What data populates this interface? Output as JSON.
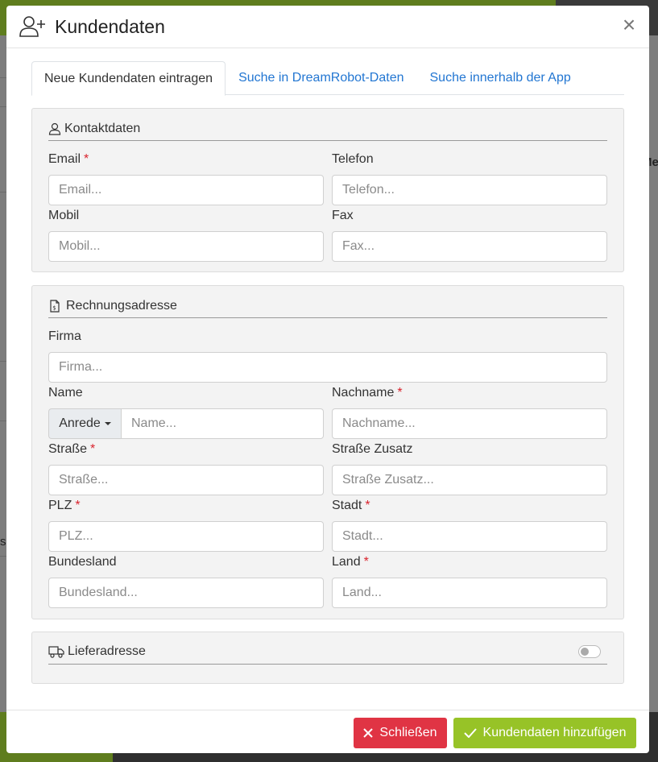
{
  "modal": {
    "title": "Kundendaten",
    "close_symbol": "×",
    "header_icon": "user-plus-icon"
  },
  "tabs": [
    {
      "label": "Neue Kundendaten eintragen",
      "active": true
    },
    {
      "label": "Suche in DreamRobot-Daten",
      "active": false
    },
    {
      "label": "Suche innerhalb der App",
      "active": false
    }
  ],
  "contact": {
    "title": "Kontaktdaten",
    "icon": "user-icon",
    "email": {
      "label": "Email",
      "placeholder": "Email...",
      "value": ""
    },
    "telefon": {
      "label": "Telefon",
      "placeholder": "Telefon...",
      "value": ""
    },
    "mobil": {
      "label": "Mobil",
      "placeholder": "Mobil...",
      "value": ""
    },
    "fax": {
      "label": "Fax",
      "placeholder": "Fax...",
      "value": ""
    }
  },
  "billing": {
    "title": "Rechnungsadresse",
    "icon": "invoice-icon",
    "firma": {
      "label": "Firma",
      "placeholder": "Firma..."
    },
    "name": {
      "label": "Name",
      "placeholder": "Name...",
      "salutation": "Anrede"
    },
    "nachname": {
      "label": "Nachname",
      "placeholder": "Nachname..."
    },
    "strasse": {
      "label": "Straße",
      "placeholder": "Straße..."
    },
    "strasse_zusatz": {
      "label": "Straße Zusatz",
      "placeholder": "Straße Zusatz..."
    },
    "plz": {
      "label": "PLZ",
      "placeholder": "PLZ..."
    },
    "stadt": {
      "label": "Stadt",
      "placeholder": "Stadt..."
    },
    "bundesland": {
      "label": "Bundesland",
      "placeholder": "Bundesland..."
    },
    "land": {
      "label": "Land",
      "placeholder": "Land..."
    }
  },
  "delivery": {
    "title": "Lieferadresse",
    "icon": "truck-icon",
    "toggle_on": false
  },
  "required_marker": "*",
  "footer": {
    "close_label": "Schließen",
    "add_label": "Kundendaten hinzufügen"
  },
  "background": {
    "right_text": "Me",
    "left_text": "s"
  },
  "colors": {
    "link": "#2276d2",
    "danger": "#e03444",
    "success": "#97c327",
    "required": "#d9232d"
  }
}
